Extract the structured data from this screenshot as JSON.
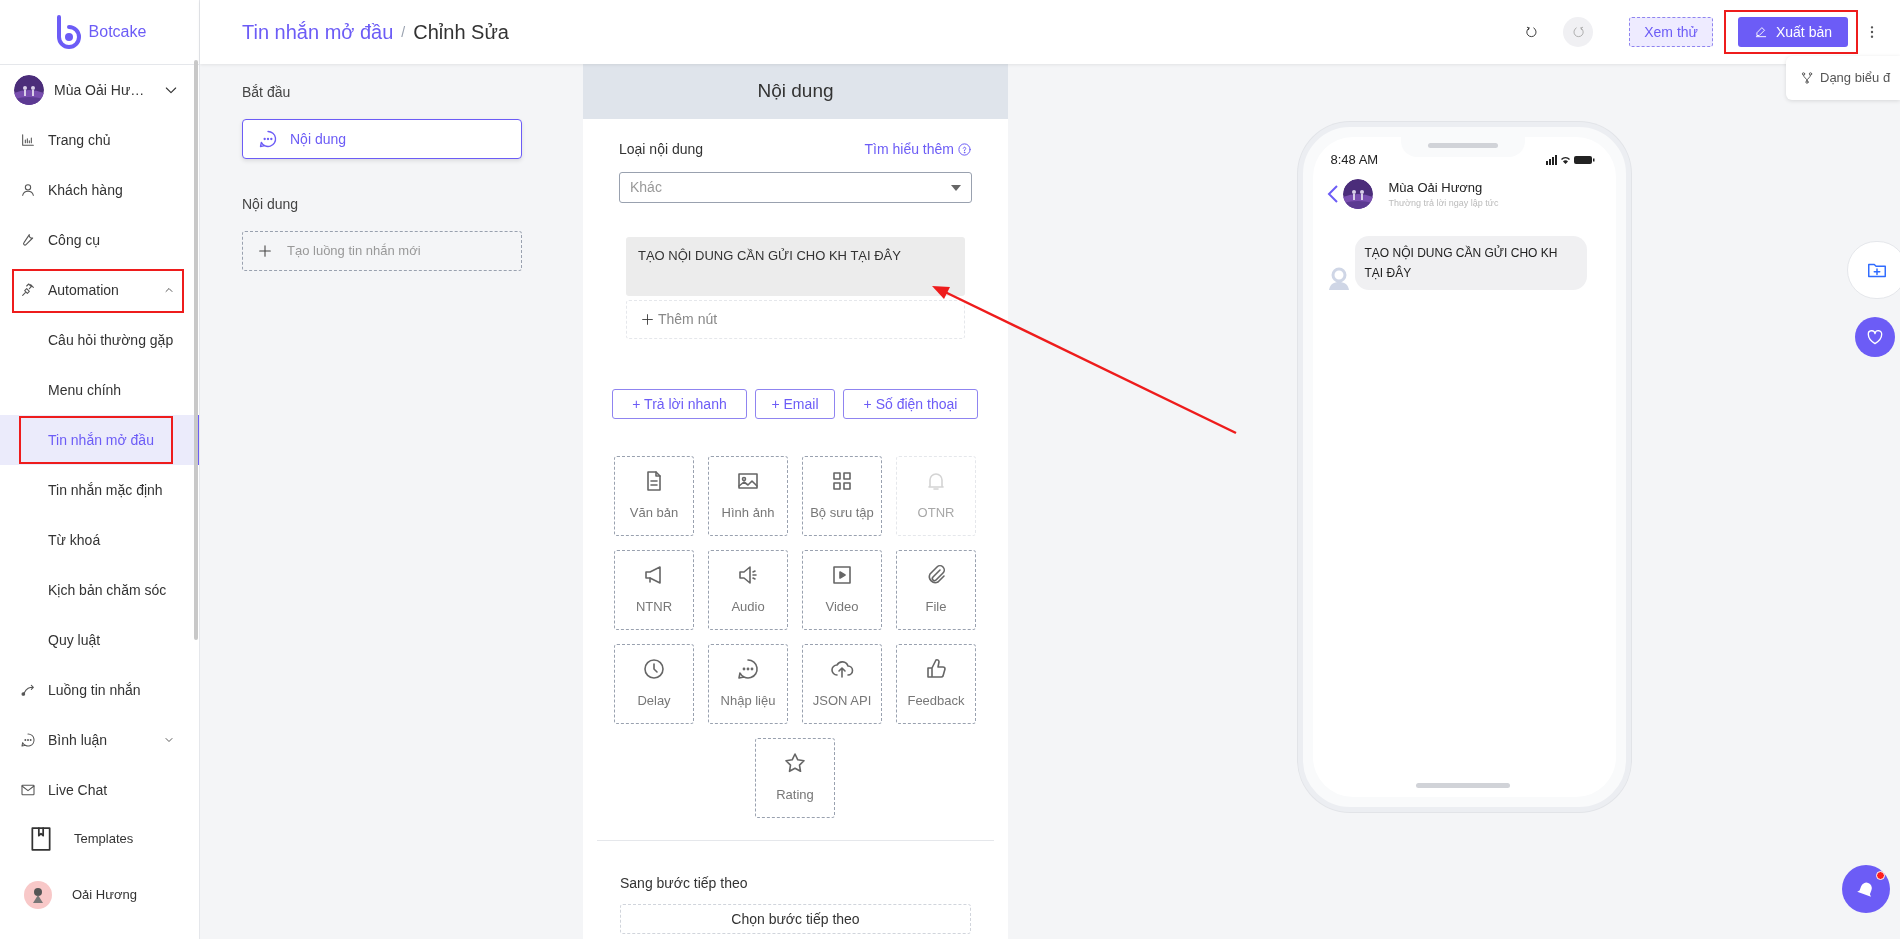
{
  "brand": "Botcake",
  "account": {
    "name": "Mùa Oải Hư…"
  },
  "sidebar": {
    "items": [
      {
        "label": "Trang chủ",
        "selected": false,
        "highlighted": false
      },
      {
        "label": "Khách hàng",
        "selected": false,
        "highlighted": false
      },
      {
        "label": "Công cụ",
        "selected": false,
        "highlighted": false
      },
      {
        "label": "Automation",
        "selected": false,
        "highlighted": true,
        "expanded": true,
        "children": [
          {
            "label": "Câu hỏi thường gặp",
            "selected": false,
            "highlighted": false
          },
          {
            "label": "Menu chính",
            "selected": false,
            "highlighted": false
          },
          {
            "label": "Tin nhắn mở đầu",
            "selected": true,
            "highlighted": true
          },
          {
            "label": "Tin nhắn mặc định",
            "selected": false,
            "highlighted": false
          },
          {
            "label": "Từ khoá",
            "selected": false,
            "highlighted": false
          },
          {
            "label": "Kịch bản chăm sóc",
            "selected": false,
            "highlighted": false
          },
          {
            "label": "Quy luật",
            "selected": false,
            "highlighted": false
          }
        ]
      },
      {
        "label": "Luồng tin nhắn",
        "selected": false,
        "highlighted": false
      },
      {
        "label": "Bình luận",
        "selected": false,
        "highlighted": false,
        "expanded": false
      },
      {
        "label": "Live Chat",
        "selected": false,
        "highlighted": false
      }
    ],
    "templates": "Templates",
    "user": "Oải Hương"
  },
  "header": {
    "breadcrumb": [
      {
        "label": "Tin nhắn mở đầu",
        "kind": "link"
      },
      {
        "label": "Chỉnh Sửa",
        "kind": "current"
      }
    ],
    "separator": "/",
    "preview_button": "Xem thử",
    "publish_button": {
      "label": "Xuất bản",
      "highlighted": true
    },
    "view_menu": "Dạng biểu đ"
  },
  "flow": {
    "start_title": "Bắt đầu",
    "start_node": "Nội dung",
    "content_title": "Nội dung",
    "new_flow_button": "Tạo luồng tin nhắn mới"
  },
  "editor": {
    "title": "Nội dung",
    "content_type_label": "Loại nội dung",
    "learn_more": "Tìm hiểu thêm",
    "content_type": "Khác",
    "message": "TẠO NỘI DUNG CẦN GỬI CHO KH TẠI ĐÂY",
    "add_button": "Thêm nút",
    "quick_buttons": [
      "+ Trả lời nhanh",
      "+ Email",
      "+ Số điện thoại"
    ],
    "blocks": [
      {
        "label": "Văn bản",
        "disabled": false
      },
      {
        "label": "Hình ảnh",
        "disabled": false
      },
      {
        "label": "Bộ sưu tập",
        "disabled": false
      },
      {
        "label": "OTNR",
        "disabled": true
      },
      {
        "label": "NTNR",
        "disabled": false
      },
      {
        "label": "Audio",
        "disabled": false
      },
      {
        "label": "Video",
        "disabled": false
      },
      {
        "label": "File",
        "disabled": false
      },
      {
        "label": "Delay",
        "disabled": false
      },
      {
        "label": "Nhập liệu",
        "disabled": false
      },
      {
        "label": "JSON API",
        "disabled": false
      },
      {
        "label": "Feedback",
        "disabled": false
      },
      {
        "label": "Rating",
        "disabled": false
      }
    ],
    "next_step_label": "Sang bước tiếp theo",
    "next_step_button": "Chọn bước tiếp theo"
  },
  "preview": {
    "time": "8:48 AM",
    "page_name": "Mùa Oải Hương",
    "status": "Thường trả lời ngay lập tức",
    "message": "TẠO NỘI DUNG CẦN GỬI CHO KH TẠI ĐÂY"
  },
  "notifications": {
    "unread": true
  }
}
